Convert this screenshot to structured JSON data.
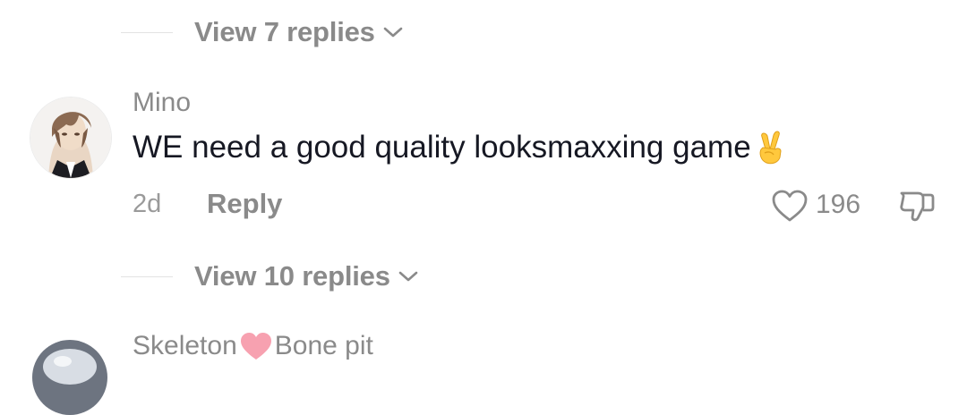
{
  "thread_top": {
    "view_replies_label": "View 7 replies"
  },
  "comment": {
    "username": "Mino",
    "text": "WE need a good quality looksmaxxing game",
    "emoji": "victory-hand-emoji",
    "time_ago": "2d",
    "reply_label": "Reply",
    "like_count": "196",
    "view_replies_label": "View 10 replies"
  },
  "next_comment": {
    "username_part1": "Skeleton",
    "username_emoji": "pink-heart-emoji",
    "username_part2": "Bone pit"
  },
  "colors": {
    "muted_text": "#8a8a8a",
    "body_text": "#161823",
    "divider": "#e3e3e3",
    "heart_pink": "#f7a1b0"
  }
}
